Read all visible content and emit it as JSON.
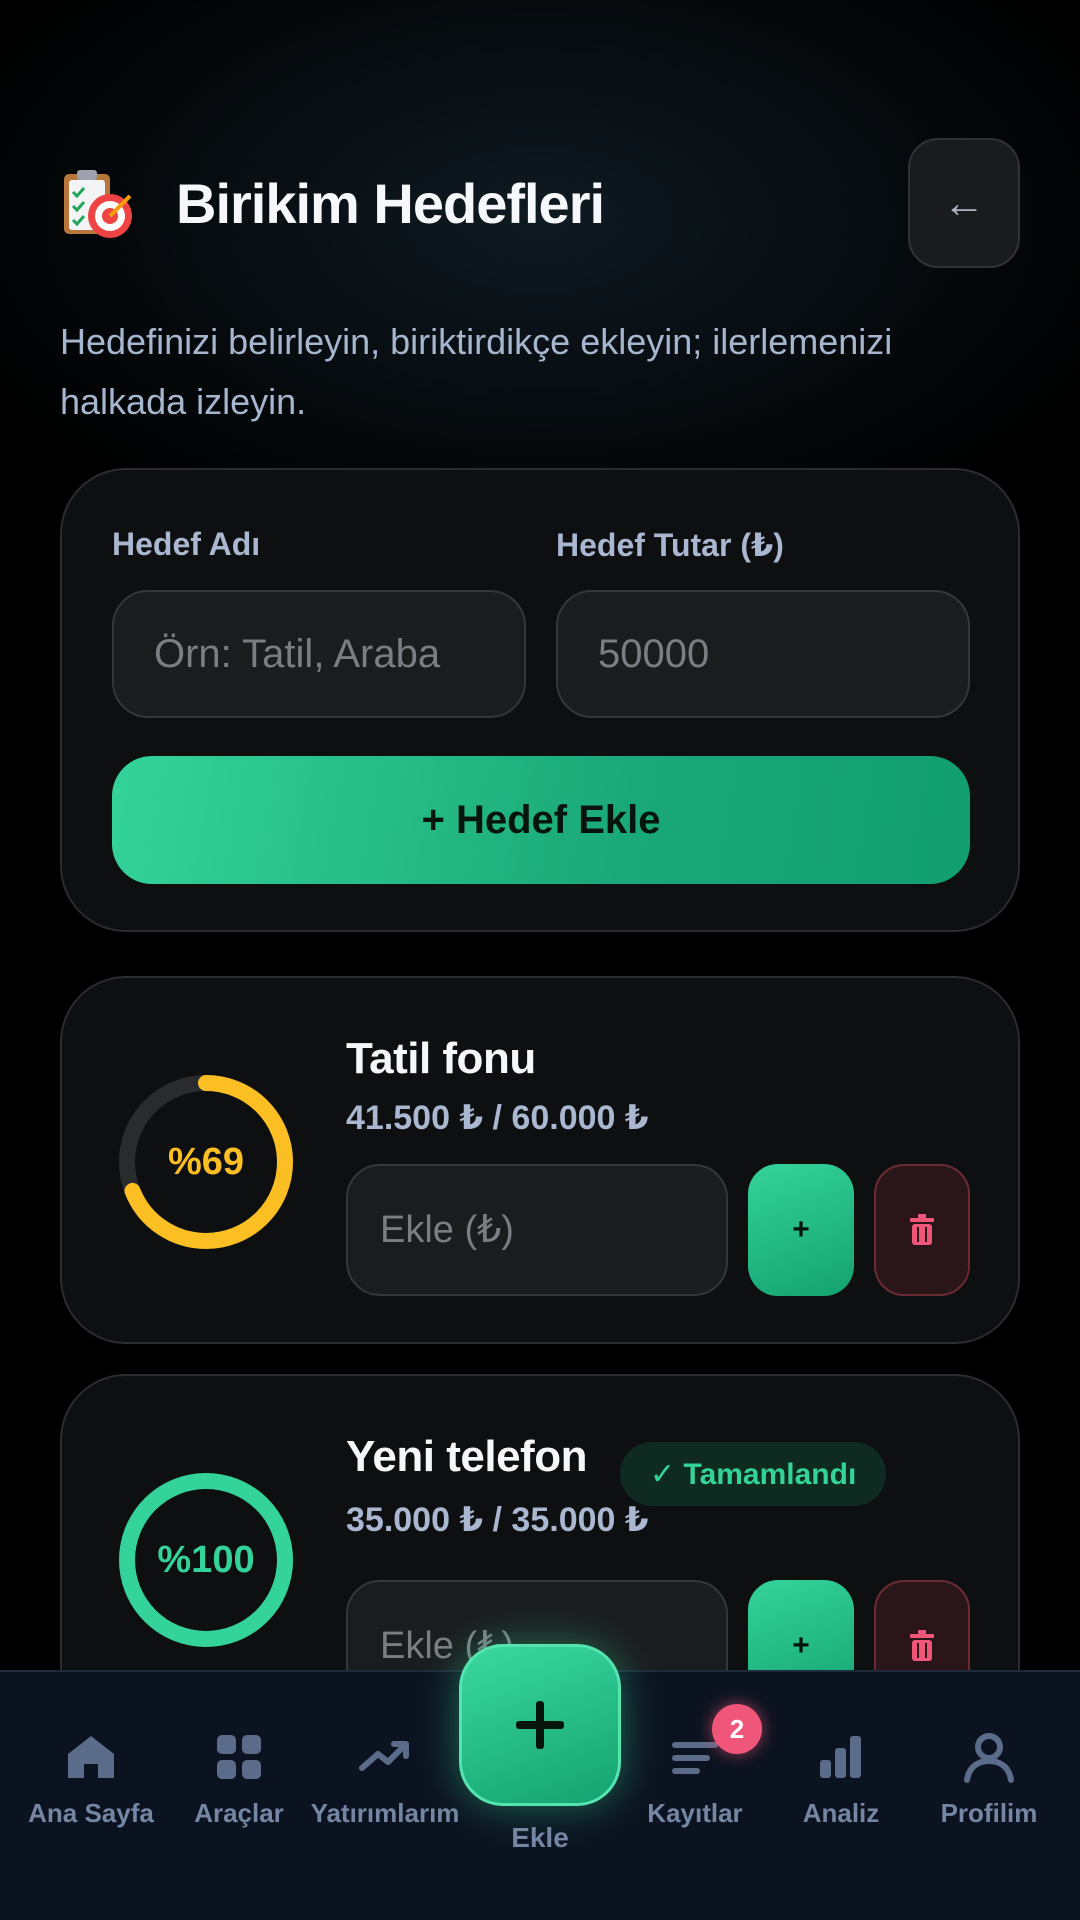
{
  "header": {
    "icon": "clipboard-target-icon",
    "title": "Birikim Hedefleri",
    "back_icon": "arrow-left-icon",
    "back_symbol": "←"
  },
  "subtitle": "Hedefinizi belirleyin, biriktirdikçe ekleyin; ilerlemenizi halkada izleyin.",
  "form": {
    "name_label": "Hedef Adı",
    "name_placeholder": "Örn: Tatil, Araba",
    "name_value": "",
    "amount_label": "Hedef Tutar (₺)",
    "amount_placeholder": "50000",
    "amount_value": "",
    "add_button": "+ Hedef Ekle"
  },
  "goals": [
    {
      "name": "Tatil fonu",
      "amount_text": "41.500 ₺ / 60.000 ₺",
      "saved": 41500,
      "target": 60000,
      "progress": 0.69,
      "percent_label": "%69",
      "ring_color": "#fbbf24",
      "completed": false,
      "badge": "",
      "input_placeholder": "Ekle (₺)",
      "add_symbol": "+",
      "delete_icon": "trash-icon"
    },
    {
      "name": "Yeni telefon",
      "amount_text": "35.000 ₺ / 35.000 ₺",
      "saved": 35000,
      "target": 35000,
      "progress": 1.0,
      "percent_label": "%100",
      "ring_color": "#34d399",
      "completed": true,
      "badge": "✓ Tamamlandı",
      "input_placeholder": "Ekle (₺)",
      "add_symbol": "+",
      "delete_icon": "trash-icon"
    }
  ],
  "nav": {
    "items": [
      {
        "label": "Ana Sayfa",
        "icon": "home-icon"
      },
      {
        "label": "Araçlar",
        "icon": "grid-icon"
      },
      {
        "label": "Yatırımlarım",
        "icon": "trending-up-icon"
      },
      {
        "label": "Kayıtlar",
        "icon": "list-icon"
      },
      {
        "label": "Analiz",
        "icon": "bar-chart-icon"
      },
      {
        "label": "Profilim",
        "icon": "user-icon"
      }
    ],
    "fab_label": "Ekle",
    "fab_icon": "plus-icon",
    "records_badge": "2"
  },
  "colors": {
    "accent": "#34d399",
    "warning": "#fbbf24",
    "danger": "#f0567a",
    "ring_track": "#2a2b2e"
  }
}
